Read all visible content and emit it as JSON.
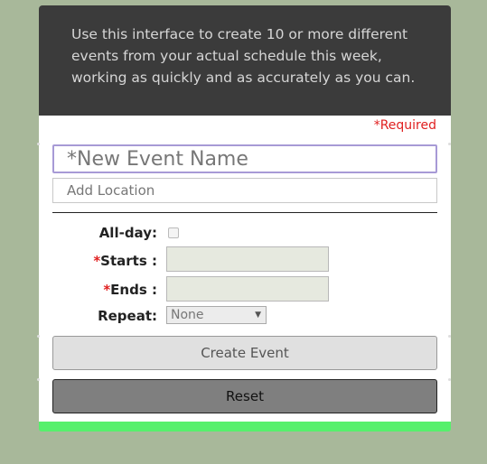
{
  "intro": {
    "text": "Use this interface to create 10 or more different events from your actual schedule this week, working as quickly and as accurately as you can."
  },
  "form": {
    "required_note": "*Required",
    "event_name": {
      "value": "",
      "placeholder": "*New Event Name"
    },
    "location": {
      "value": "",
      "placeholder": "Add Location"
    },
    "all_day": {
      "label": "All-day",
      "colon": ":",
      "checked": false
    },
    "starts": {
      "star": "*",
      "label": "Starts",
      "colon": " :",
      "value": ""
    },
    "ends": {
      "star": "*",
      "label": "Ends",
      "colon": " :",
      "value": ""
    },
    "repeat": {
      "label": "Repeat",
      "colon": ":",
      "selected": "None",
      "arrow_icon": "dropdown-triangle-icon"
    },
    "create_button": "Create Event",
    "reset_button": "Reset"
  },
  "colors": {
    "background": "#a8b89a",
    "intro_bg": "#3b3b3b",
    "required": "#e02020",
    "accent_bar": "#56f06c"
  }
}
